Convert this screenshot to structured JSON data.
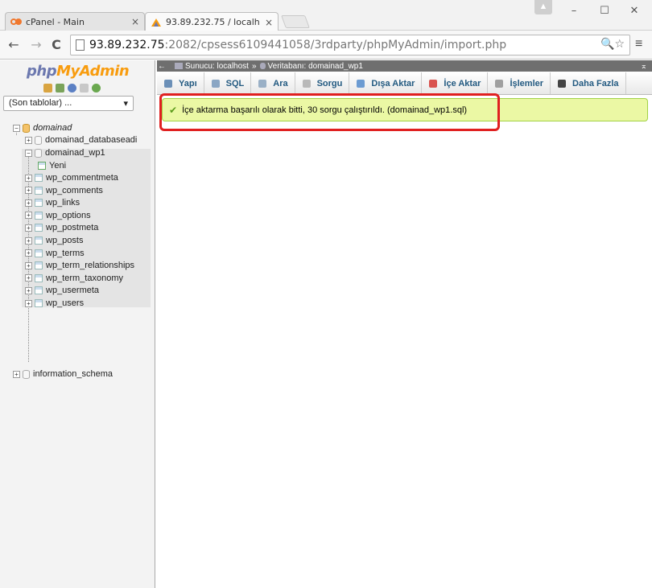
{
  "browser": {
    "tabs": [
      {
        "title": "cPanel - Main",
        "close": "×"
      },
      {
        "title": "93.89.232.75 / localhost / ",
        "close": "×"
      }
    ],
    "window_controls": {
      "minimize": "–",
      "maximize": "☐",
      "close": "✕"
    },
    "nav": {
      "back": "←",
      "forward": "→",
      "reload": "C"
    },
    "url": {
      "host": "93.89.232.75",
      "path": ":2082/cpsess6109441058/3rdparty/phpMyAdmin/import.php"
    },
    "omnibox_icons": "🔍☆",
    "menu": "≡"
  },
  "sidebar": {
    "logo_php": "php",
    "logo_myadmin": "MyAdmin",
    "recent_select": "(Son tablolar) ...",
    "recent_arrow": "▾",
    "databases": [
      {
        "name": "domainad",
        "expander": "−"
      },
      {
        "name": "domainad_databaseadi",
        "expander": "+"
      },
      {
        "name": "domainad_wp1",
        "expander": "−"
      },
      {
        "name": "information_schema",
        "expander": "+"
      }
    ],
    "new_label": "Yeni",
    "tables": [
      "wp_commentmeta",
      "wp_comments",
      "wp_links",
      "wp_options",
      "wp_postmeta",
      "wp_posts",
      "wp_terms",
      "wp_term_relationships",
      "wp_term_taxonomy",
      "wp_usermeta",
      "wp_users"
    ]
  },
  "breadcrumb": {
    "collapse": "←",
    "server": "Sunucu: localhost",
    "sep": "»",
    "database": "Veritabanı: domainad_wp1",
    "maximize": "⌅"
  },
  "topmenu": [
    {
      "label": "Yapı",
      "color": "#6b8fb7"
    },
    {
      "label": "SQL",
      "color": "#8aa6c4"
    },
    {
      "label": "Ara",
      "color": "#9ab0c6"
    },
    {
      "label": "Sorgu",
      "color": "#b9b9b9"
    },
    {
      "label": "Dışa Aktar",
      "color": "#6c9bd2"
    },
    {
      "label": "İçe Aktar",
      "color": "#d9534f"
    },
    {
      "label": "İşlemler",
      "color": "#a0a0a0"
    },
    {
      "label": "Daha Fazla",
      "color": "#444444"
    }
  ],
  "message": {
    "icon": "✔",
    "text": "İçe aktarma başarılı olarak bitti, 30 sorgu çalıştırıldı. (domainad_wp1.sql)"
  }
}
